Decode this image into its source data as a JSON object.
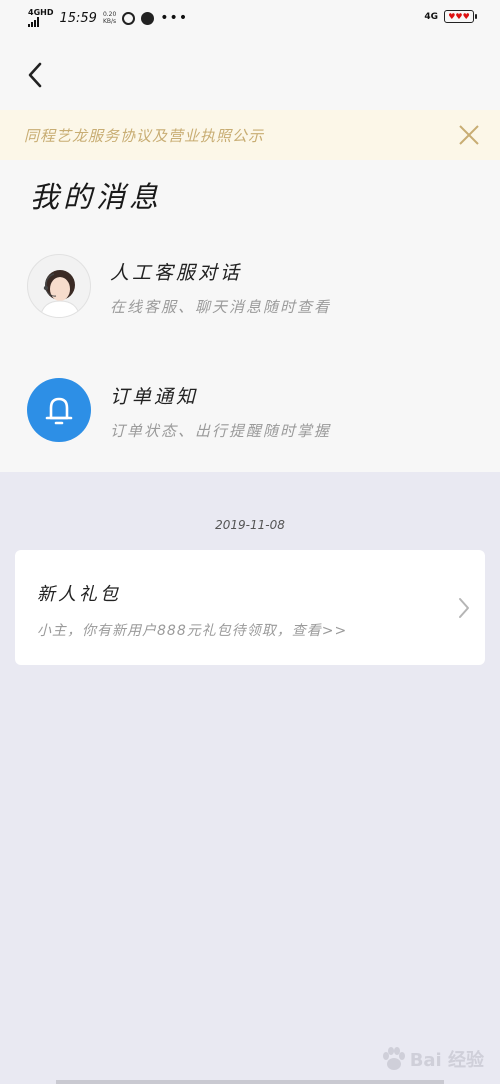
{
  "status_bar": {
    "network": "4GHD",
    "time": "15:59",
    "speed": "0.20\nKB/s",
    "dots": "•••",
    "network_right": "4G"
  },
  "notice": {
    "text": "同程艺龙服务协议及营业执照公示"
  },
  "page": {
    "title": "我的消息"
  },
  "messages": [
    {
      "title": "人工客服对话",
      "subtitle": "在线客服、聊天消息随时查看",
      "icon": "customer-service-avatar"
    },
    {
      "title": "订单通知",
      "subtitle": "订单状态、出行提醒随时掌握",
      "icon": "bell-icon"
    }
  ],
  "feed": {
    "date": "2019-11-08",
    "card": {
      "title": "新人礼包",
      "subtitle": "小主，你有新用户888元礼包待领取，查看>>"
    }
  },
  "watermark": {
    "text": "Bai 经验"
  },
  "colors": {
    "notice_bg": "#fcf7e8",
    "notice_text": "#c8ad73",
    "bell_bg": "#2d8fe6",
    "page_bg": "#e9e9f2"
  }
}
